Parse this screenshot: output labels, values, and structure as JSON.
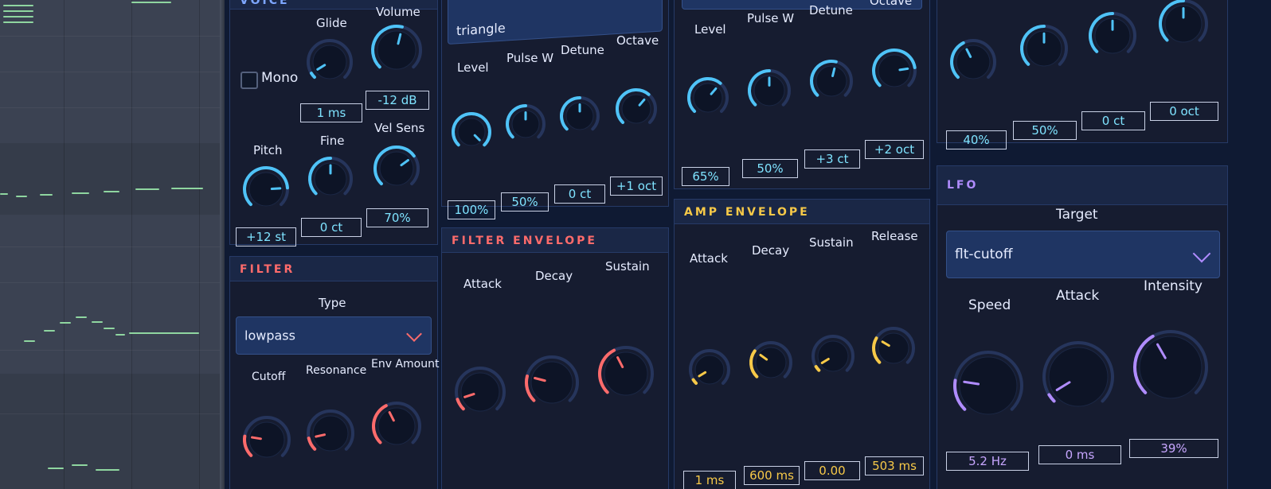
{
  "voice": {
    "title": "VOICE",
    "mono_label": "Mono",
    "labels": {
      "glide": "Glide",
      "volume": "Volume",
      "pitch": "Pitch",
      "fine": "Fine",
      "vel_sens": "Vel Sens"
    },
    "values": {
      "glide": "1 ms",
      "volume": "-12 dB",
      "pitch": "+12 st",
      "fine": "0 ct",
      "vel_sens": "70%"
    }
  },
  "osc1": {
    "wave": "triangle",
    "labels": {
      "level": "Level",
      "pulse_w": "Pulse W",
      "detune": "Detune",
      "octave": "Octave"
    },
    "values": {
      "level": "100%",
      "pulse_w": "50%",
      "detune": "0 ct",
      "octave": "+1 oct"
    }
  },
  "osc2": {
    "labels": {
      "level": "Level",
      "pulse_w": "Pulse W",
      "detune": "Detune",
      "octave": "Octave"
    },
    "values": {
      "level": "65%",
      "pulse_w": "50%",
      "detune": "+3 ct",
      "octave": "+2 oct"
    }
  },
  "osc3": {
    "values": {
      "level": "40%",
      "pulse_w": "50%",
      "detune": "0 ct",
      "octave": "0 oct"
    }
  },
  "filter": {
    "title": "FILTER",
    "type_label": "Type",
    "type_value": "lowpass",
    "labels": {
      "cutoff": "Cutoff",
      "resonance": "Resonance",
      "env_amount": "Env Amount"
    }
  },
  "filter_env": {
    "title": "FILTER ENVELOPE",
    "labels": {
      "attack": "Attack",
      "decay": "Decay",
      "sustain": "Sustain"
    }
  },
  "amp_env": {
    "title": "AMP ENVELOPE",
    "labels": {
      "attack": "Attack",
      "decay": "Decay",
      "sustain": "Sustain",
      "release": "Release"
    },
    "values": {
      "attack": "1 ms",
      "decay": "600 ms",
      "sustain": "0.00",
      "release": "503 ms"
    }
  },
  "lfo": {
    "title": "LFO",
    "target_label": "Target",
    "target_value": "flt-cutoff",
    "labels": {
      "speed": "Speed",
      "attack": "Attack",
      "intensity": "Intensity"
    },
    "values": {
      "speed": "5.2 Hz",
      "attack": "0 ms",
      "intensity": "39%"
    }
  },
  "colors": {
    "panel_bg": "#161c30",
    "header_bg": "#1a2746",
    "cyan": "#4fc3f7",
    "red": "#ff6b6b",
    "yellow": "#f7c948",
    "purple": "#b08cff",
    "note_green": "#8fd6a0"
  }
}
